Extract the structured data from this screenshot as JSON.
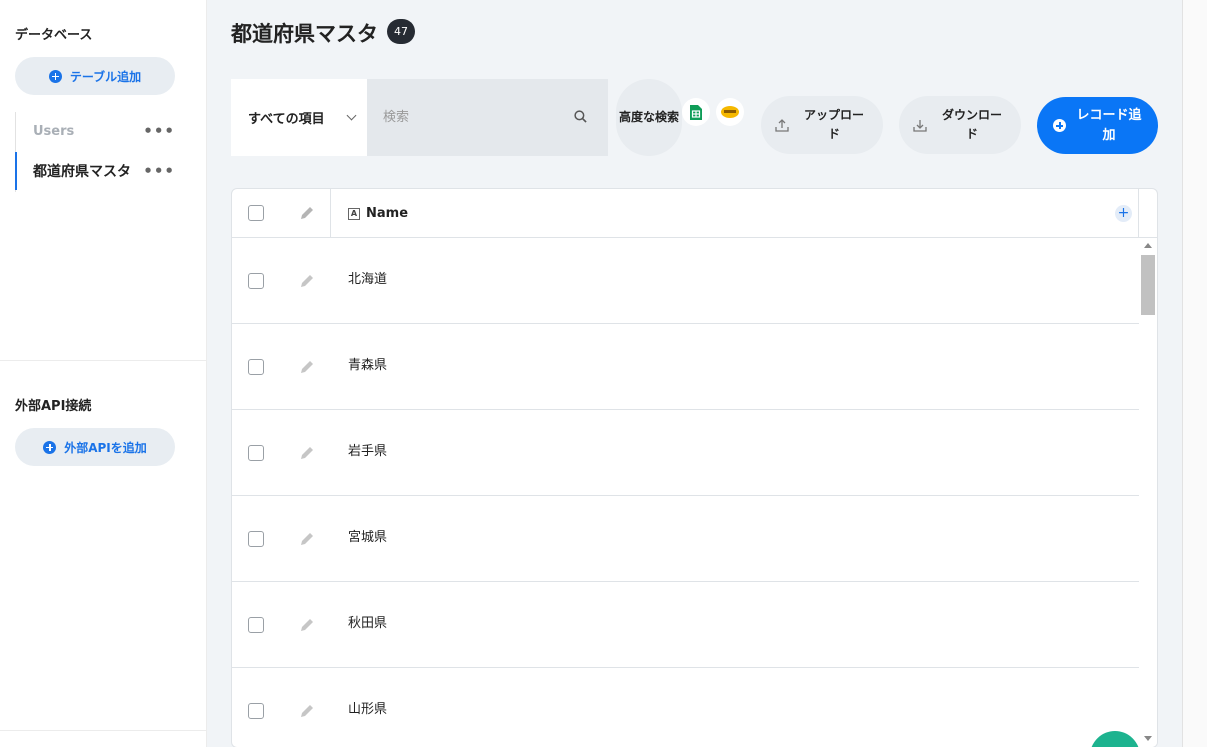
{
  "sidebar": {
    "database_title": "データベース",
    "add_table_label": "テーブル追加",
    "tables": [
      {
        "label": "Users",
        "menu": "•••"
      },
      {
        "label": "都道府県マスタ",
        "menu": "•••"
      }
    ],
    "external_api_title": "外部API接続",
    "add_external_api_label": "外部APIを追加"
  },
  "header": {
    "title": "都道府県マスタ",
    "count": "47"
  },
  "toolbar": {
    "filter_selected": "すべての項目",
    "search_placeholder": "検索",
    "advanced_search_label": "高度な検索",
    "upload_label": "アップロード",
    "download_label": "ダウンロード",
    "add_record_label": "レコード追加",
    "icons": [
      "google-sheets-icon",
      "kintone-icon"
    ]
  },
  "table": {
    "columns": [
      {
        "label": "Name",
        "type_icon": "A"
      }
    ],
    "add_column_label": "+",
    "rows": [
      "北海道",
      "青森県",
      "岩手県",
      "宮城県",
      "秋田県",
      "山形県"
    ]
  },
  "colors": {
    "accent": "#0a76f6",
    "sidebar_accent": "#1a73e8",
    "badge_bg": "#262b33",
    "main_bg": "#f1f4f7",
    "fab": "#1db38f"
  }
}
